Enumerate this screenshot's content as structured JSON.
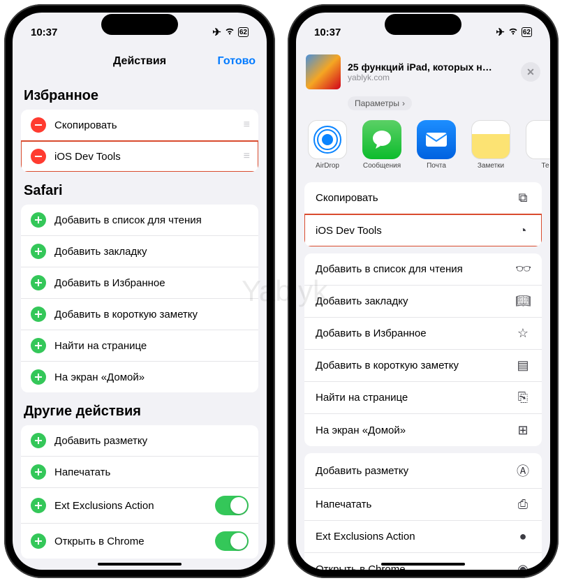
{
  "watermark": "Yablyk",
  "status": {
    "time": "10:37",
    "battery": "62"
  },
  "left": {
    "nav": {
      "title": "Действия",
      "done": "Готово"
    },
    "sections": {
      "favorites": {
        "header": "Избранное",
        "items": [
          "Скопировать",
          "iOS Dev Tools"
        ]
      },
      "safari": {
        "header": "Safari",
        "items": [
          "Добавить в список для чтения",
          "Добавить закладку",
          "Добавить в Избранное",
          "Добавить в короткую заметку",
          "Найти на странице",
          "На экран «Домой»"
        ]
      },
      "other": {
        "header": "Другие действия",
        "items": [
          "Добавить разметку",
          "Напечатать",
          "Ext Exclusions Action",
          "Открыть в Chrome"
        ]
      }
    }
  },
  "right": {
    "share": {
      "title": "25 функций iPad, которых н…",
      "subtitle": "yablyk.com",
      "params": "Параметры"
    },
    "apps": [
      "AirDrop",
      "Сообщения",
      "Почта",
      "Заметки",
      "Те"
    ],
    "primary": [
      "Скопировать",
      "iOS Dev Tools"
    ],
    "actions": [
      "Добавить в список для чтения",
      "Добавить закладку",
      "Добавить в Избранное",
      "Добавить в короткую заметку",
      "Найти на странице",
      "На экран «Домой»"
    ],
    "more": [
      "Добавить разметку",
      "Напечатать",
      "Ext Exclusions Action",
      "Открыть в Chrome"
    ]
  }
}
